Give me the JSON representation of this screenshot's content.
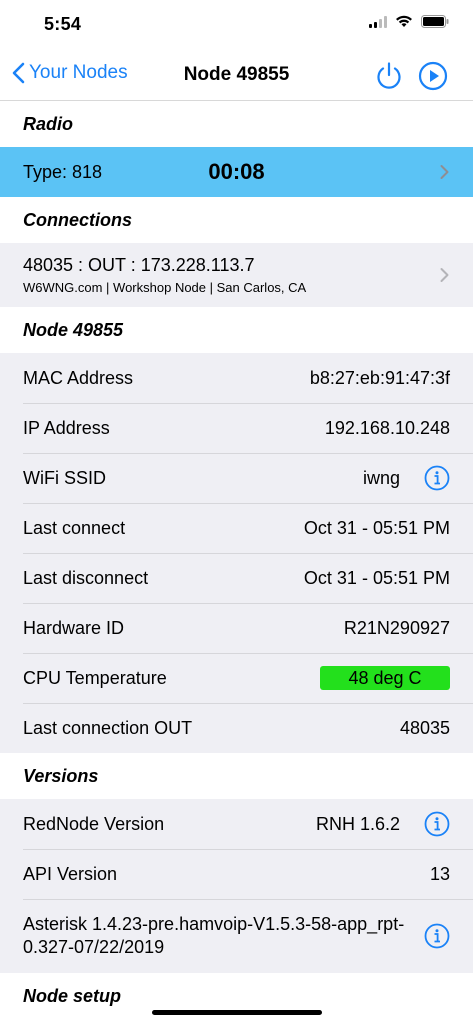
{
  "status_bar": {
    "time": "5:54"
  },
  "nav": {
    "back_label": "Your Nodes",
    "title": "Node 49855"
  },
  "radio": {
    "header": "Radio",
    "type_label": "Type: 818",
    "timer": "00:08"
  },
  "connections": {
    "header": "Connections",
    "items": [
      {
        "main": "48035 : OUT : 173.228.113.7",
        "sub": "W6WNG.com | Workshop Node | San Carlos, CA"
      }
    ]
  },
  "node": {
    "header": "Node 49855",
    "rows": [
      {
        "label": "MAC Address",
        "value": "b8:27:eb:91:47:3f"
      },
      {
        "label": "IP Address",
        "value": "192.168.10.248"
      },
      {
        "label": "WiFi SSID",
        "value": "iwng"
      },
      {
        "label": "Last connect",
        "value": "Oct 31 - 05:51 PM"
      },
      {
        "label": "Last disconnect",
        "value": "Oct 31 - 05:51 PM"
      },
      {
        "label": "Hardware ID",
        "value": "R21N290927"
      },
      {
        "label": "CPU Temperature",
        "value": "48 deg C"
      },
      {
        "label": "Last connection OUT",
        "value": "48035"
      }
    ]
  },
  "versions": {
    "header": "Versions",
    "rows": [
      {
        "label": "RedNode Version",
        "value": "RNH 1.6.2"
      },
      {
        "label": "API Version",
        "value": "13"
      },
      {
        "label": "Asterisk 1.4.23-pre.hamvoip-V1.5.3-58-app_rpt-0.327-07/22/2019"
      }
    ]
  },
  "node_setup": {
    "header": "Node setup"
  },
  "colors": {
    "accent": "#1a82f7",
    "radio_row": "#5bc3f5",
    "temp_ok": "#23e01c",
    "group_bg": "#efeff4"
  },
  "icons": [
    "chevron-left-icon",
    "power-icon",
    "play-circle-icon",
    "chevron-right-icon",
    "info-icon",
    "signal-icon",
    "wifi-icon",
    "battery-icon"
  ]
}
